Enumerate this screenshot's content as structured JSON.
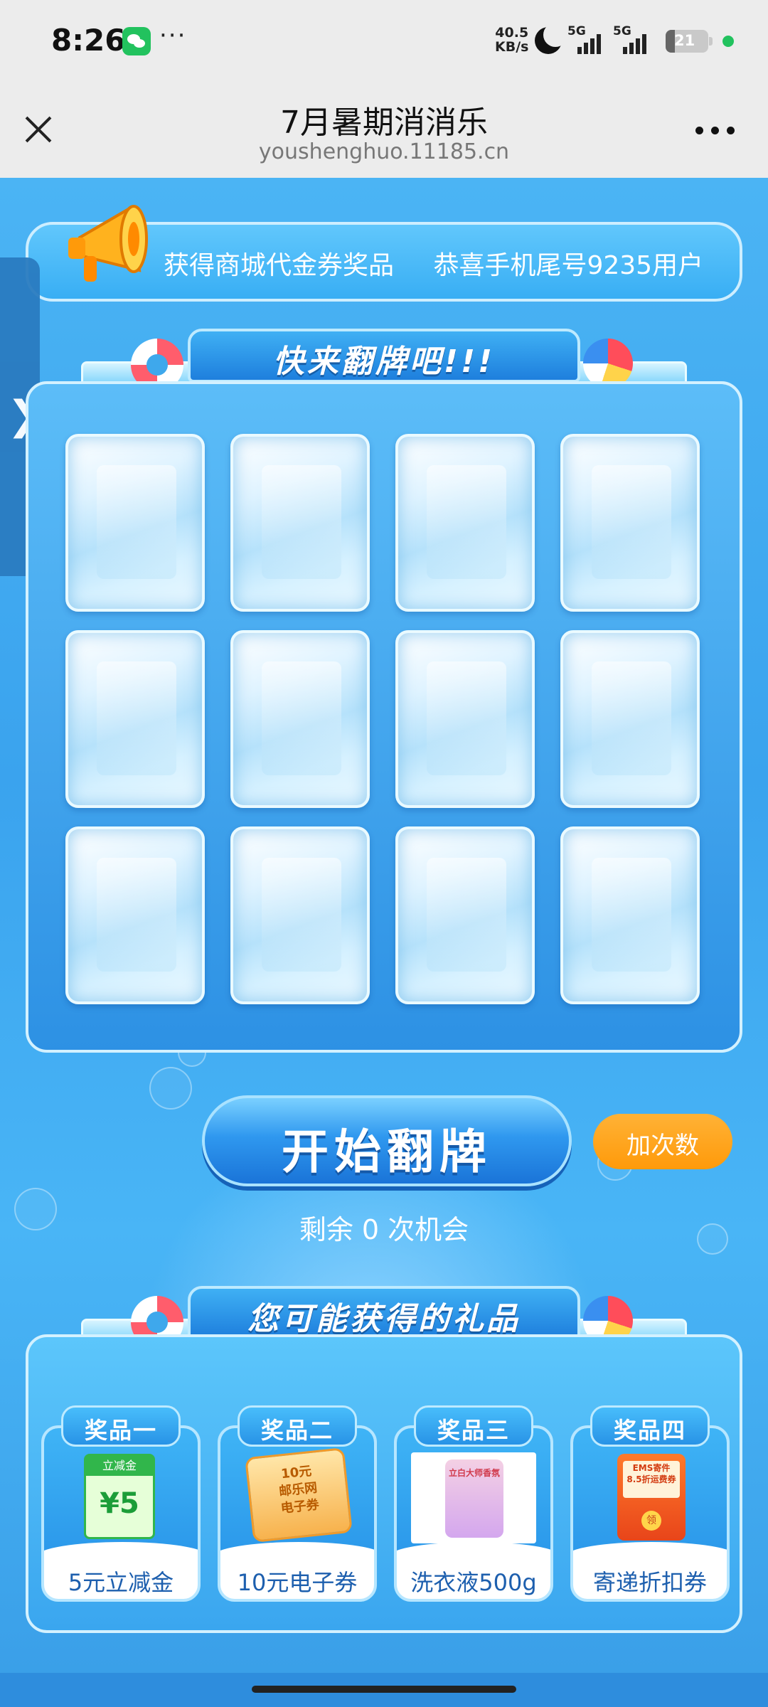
{
  "status_bar": {
    "time": "8:26",
    "more": "···",
    "network_speed_value": "40.5",
    "network_speed_unit": "KB/s",
    "signal1": "5G",
    "signal2": "5G",
    "battery": "21",
    "battery_level_percent": 21
  },
  "title_bar": {
    "title": "7月暑期消消乐",
    "url": "youshenghuo.11185.cn"
  },
  "marquee": {
    "items": [
      "获得商城代金券奖品",
      "恭喜手机尾号9235用户"
    ]
  },
  "side_handle": {
    "label": "❯"
  },
  "flip_section": {
    "banner": "快来翻牌吧!!!",
    "card_count": 12
  },
  "actions": {
    "start_button": "开始翻牌",
    "add_button": "加次数",
    "chances_text": "剩余 0 次机会"
  },
  "prize_section": {
    "banner": "您可能获得的礼品",
    "prizes": [
      {
        "tag": "奖品一",
        "name": "5元立减金",
        "image_text_header": "立减金",
        "image_text_amount": "¥5"
      },
      {
        "tag": "奖品二",
        "name": "10元电子券",
        "image_text": "10元\n邮乐网\n电子券"
      },
      {
        "tag": "奖品三",
        "name": "洗衣液500g",
        "image_text": "立白大师香氛"
      },
      {
        "tag": "奖品四",
        "name": "寄递折扣券",
        "image_text": "EMS寄件\n8.5折运费券",
        "seal": "领"
      }
    ]
  },
  "colors": {
    "page_bg": "#3da6ef",
    "accent_orange": "#ff9a0a",
    "prize_text": "#1d5fae"
  }
}
